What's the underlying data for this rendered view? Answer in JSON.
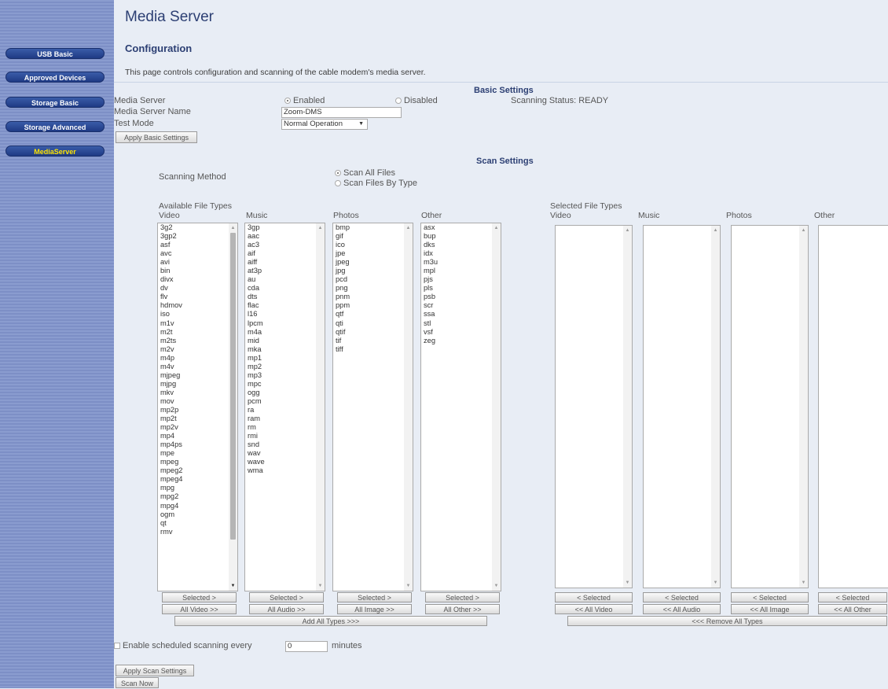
{
  "nav": {
    "items": [
      {
        "label": "USB Basic"
      },
      {
        "label": "Approved Devices"
      },
      {
        "label": "Storage Basic"
      },
      {
        "label": "Storage Advanced"
      },
      {
        "label": "MediaServer"
      }
    ],
    "active_color": "#ffe500"
  },
  "page": {
    "title": "Media Server",
    "subtitle": "Configuration",
    "description": "This page controls configuration and scanning of the cable modem's media server."
  },
  "basic": {
    "heading": "Basic Settings",
    "media_server_label": "Media Server",
    "enabled_label": "Enabled",
    "disabled_label": "Disabled",
    "selected": "Enabled",
    "scanning_status": "Scanning Status: READY",
    "name_label": "Media Server Name",
    "name_value": "Zoom-DMS",
    "test_mode_label": "Test Mode",
    "test_mode_value": "Normal Operation",
    "apply_button": "Apply Basic Settings"
  },
  "scan": {
    "heading": "Scan Settings",
    "method_label": "Scanning Method",
    "options": [
      "Scan All Files",
      "Scan Files By Type"
    ],
    "selected_option": "Scan All Files",
    "available_label": "Available File Types",
    "selected_label": "Selected File Types",
    "columns": [
      "Video",
      "Music",
      "Photos",
      "Other"
    ],
    "video": [
      "3g2",
      "3gp2",
      "asf",
      "avc",
      "avi",
      "bin",
      "divx",
      "dv",
      "flv",
      "hdmov",
      "iso",
      "m1v",
      "m2t",
      "m2ts",
      "m2v",
      "m4p",
      "m4v",
      "mjpeg",
      "mjpg",
      "mkv",
      "mov",
      "mp2p",
      "mp2t",
      "mp2v",
      "mp4",
      "mp4ps",
      "mpe",
      "mpeg",
      "mpeg2",
      "mpeg4",
      "mpg",
      "mpg2",
      "mpg4",
      "ogm",
      "qt",
      "rmv"
    ],
    "music": [
      "3gp",
      "aac",
      "ac3",
      "aif",
      "aiff",
      "at3p",
      "au",
      "cda",
      "dts",
      "flac",
      "l16",
      "lpcm",
      "m4a",
      "mid",
      "mka",
      "mp1",
      "mp2",
      "mp3",
      "mpc",
      "ogg",
      "pcm",
      "ra",
      "ram",
      "rm",
      "rmi",
      "snd",
      "wav",
      "wave",
      "wma"
    ],
    "photos": [
      "bmp",
      "gif",
      "ico",
      "jpe",
      "jpeg",
      "jpg",
      "pcd",
      "png",
      "pnm",
      "ppm",
      "qtf",
      "qti",
      "qtif",
      "tif",
      "tiff"
    ],
    "other": [
      "asx",
      "bup",
      "dks",
      "idx",
      "m3u",
      "mpl",
      "pjs",
      "pls",
      "psb",
      "scr",
      "ssa",
      "stl",
      "vsf",
      "zeg"
    ],
    "add_buttons": [
      "Selected  >",
      "Selected  >",
      "Selected  >",
      "Selected  >"
    ],
    "all_buttons": [
      "All Video >>",
      "All Audio >>",
      "All Image >>",
      "All Other >>"
    ],
    "add_all": "Add All Types >>>",
    "remove_buttons": [
      "< Selected",
      "< Selected",
      "< Selected",
      "< Selected"
    ],
    "remove_all_buttons": [
      "<< All Video",
      "<< All Audio",
      "<< All Image",
      "<< All Other"
    ],
    "remove_all": "<<< Remove All Types",
    "schedule_label": "Enable scheduled scanning every",
    "schedule_value": "0",
    "schedule_unit": "minutes",
    "apply_button": "Apply Scan Settings",
    "scan_now": "Scan Now"
  }
}
